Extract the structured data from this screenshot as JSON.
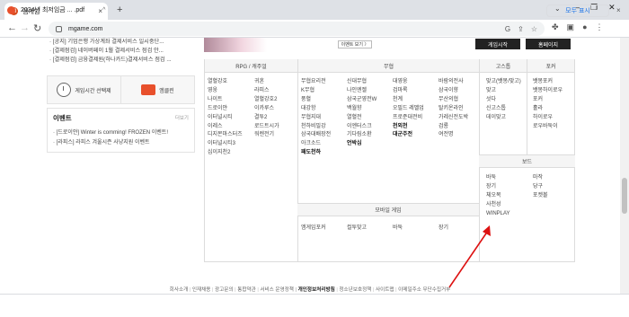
{
  "browser": {
    "tab_title": "엠게임",
    "tab_favicon": "M",
    "url": "mgame.com",
    "new_tab": "+",
    "close_tab": "×",
    "tabs_menu": "⌄"
  },
  "notices": [
    "[공지] 기업은행 가상계좌 결제서비스 일시중단...",
    "[결제점검] 네이버페이 1월 결제서비스 점검 안...",
    "[결제점검] 금융결제원(하나카드)결제서비스 점검 ..."
  ],
  "shortcuts": {
    "timer": "게임시간 선택제",
    "pcbang": "엠클린"
  },
  "events": {
    "title": "이벤트",
    "more": "더보기",
    "items": [
      "[드로이얀] Winter is comming! FROZEN 이벤트!",
      "[라피스] 라피스 겨울시즌 사냥지원 이벤트"
    ]
  },
  "banner": {
    "view_btn": "이벤트 보기 〉",
    "start_btn": "게임시작",
    "home_btn": "홈페이지"
  },
  "grid": {
    "headers": {
      "rpg": "RPG / 캐주얼",
      "martial": "무협",
      "gostop": "고스톱",
      "poker": "포커",
      "board": "보드",
      "mobile": "모바일 게임"
    },
    "rpg_col1": [
      "열혈강호",
      "영웅",
      "나이트",
      "드로이얀",
      "이터널시티",
      "이레스",
      "디지몬마스터즈",
      "이터널시티3",
      "십이지천2"
    ],
    "rpg_col2": [
      "귀혼",
      "라피스",
      "열혈강호2",
      "이카루스",
      "결투2",
      "로드트시가",
      "워렌전기"
    ],
    "martial_col1": [
      "무협요리전",
      "K무협",
      "풍혈",
      "대강항",
      "무협지대",
      "천하비밀강",
      "삼국대배장전",
      "아크소드",
      "패도천하"
    ],
    "martial_col2": [
      "신대무협",
      "나인엔젤",
      "삼국군영전W",
      "백월향",
      "열혈전",
      "이엔터스크",
      "기다림소환",
      "언박심"
    ],
    "martial_col3": [
      "대영웅",
      "검마록",
      "천계",
      "오필드 레벨업",
      "프로준대전비",
      "천외천",
      "대군주전"
    ],
    "martial_col4": [
      "바람의전사",
      "삼국이향",
      "무산의협",
      "탈키온라인",
      "가레신전도박",
      "검룡",
      "여전명"
    ],
    "gostop": [
      "맞고(뱃몽/맞고)",
      "맞고",
      "섯다",
      "신고스톱",
      "데이맞고"
    ],
    "poker": [
      "뱃몽포커",
      "뱃몽하이로우",
      "포커",
      "홀라",
      "하이로우",
      "로우바둑이"
    ],
    "board_col1": [
      "바둑",
      "장기",
      "체오목",
      "사천성",
      "WINPLAY"
    ],
    "board_col2": [
      "마작",
      "당구",
      "포켓볼"
    ],
    "mobile": [
      "엠게임포커",
      "컬투맞고",
      "바둑",
      "장기"
    ]
  },
  "footer": [
    "회사소개",
    "인재채용",
    "광고문의",
    "통합약관",
    "서비스 운영정책",
    "개인정보처리방침",
    "청소년보호정책",
    "사이트맵",
    "이메일주소 무단수집거부"
  ],
  "download": {
    "file": "2024년 최저임금 ... .pdf",
    "show_all": "모두 표시",
    "close": "×"
  }
}
